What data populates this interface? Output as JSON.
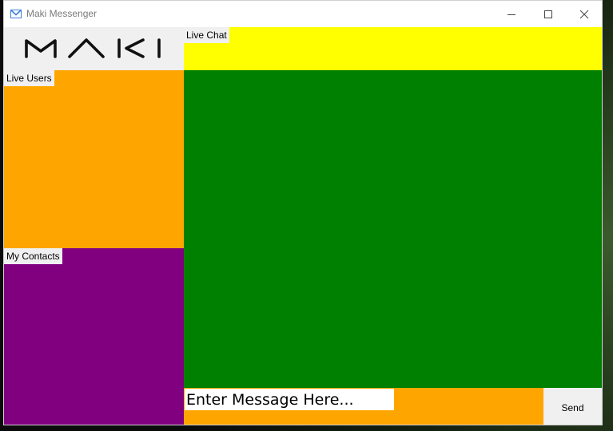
{
  "window": {
    "title": "Maki Messenger",
    "icon": "mail-icon",
    "controls": {
      "minimize": "minimize-icon",
      "maximize": "maximize-icon",
      "close": "close-icon"
    }
  },
  "branding": {
    "logo_text": "MAKI"
  },
  "panels": {
    "live_chat_label": "Live Chat",
    "live_users_label": "Live Users",
    "contacts_label": "My Contacts"
  },
  "composer": {
    "placeholder": "Enter Message Here...",
    "value": "",
    "send_label": "Send"
  },
  "colors": {
    "live_chat_header": "#ffff00",
    "live_users_panel": "#ffa500",
    "contacts_panel": "#800080",
    "chat_area": "#008000",
    "input_bar": "#ffa500",
    "accent_icon": "#3d7edb"
  }
}
